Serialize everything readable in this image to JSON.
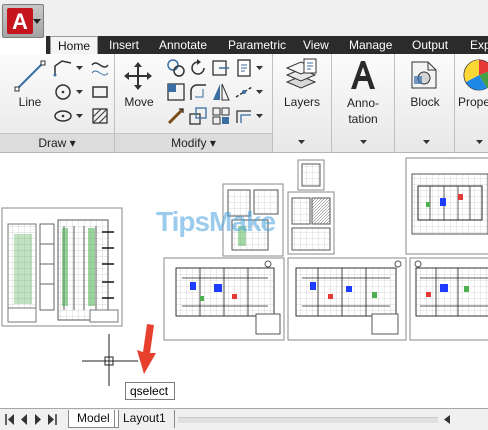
{
  "app": {
    "logo_letter": "A",
    "accent": "#c4161c"
  },
  "ribbon_tabs": [
    "Home",
    "Insert",
    "Annotate",
    "Parametric",
    "View",
    "Manage",
    "Output",
    "Exp"
  ],
  "active_tab": "Home",
  "draw_panel": {
    "line_label": "Line",
    "footer": "Draw ▾"
  },
  "modify_panel": {
    "move_label": "Move",
    "footer": "Modify ▾"
  },
  "layers_panel": {
    "label": "Layers"
  },
  "annotation_panel": {
    "label_line1": "Anno-",
    "label_line2": "tation"
  },
  "block_panel": {
    "label": "Block"
  },
  "properties_panel": {
    "label": "Prope"
  },
  "watermark": "TipsMake",
  "command_tooltip": "qselect",
  "layout_tabs": [
    "Model",
    "Layout1"
  ],
  "active_layout": "Model",
  "colors": {
    "tab_bar": "#2b2b2b",
    "ribbon": "#f4f4f4",
    "arrow": "#e8402e"
  }
}
